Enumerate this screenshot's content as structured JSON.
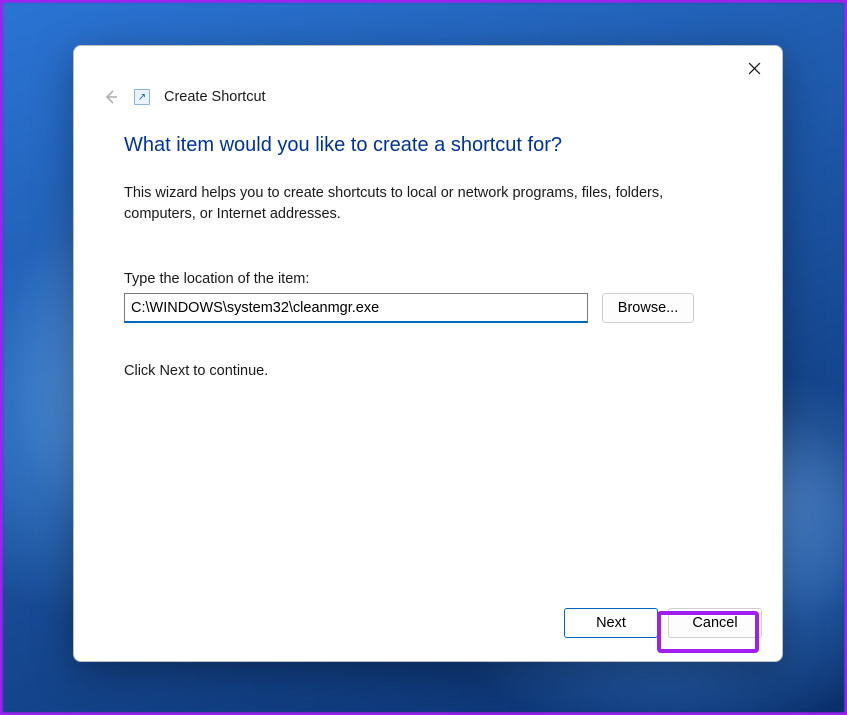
{
  "window": {
    "title": "Create Shortcut"
  },
  "wizard": {
    "heading": "What item would you like to create a shortcut for?",
    "description": "This wizard helps you to create shortcuts to local or network programs, files, folders, computers, or Internet addresses.",
    "location_label": "Type the location of the item:",
    "location_value": "C:\\WINDOWS\\system32\\cleanmgr.exe",
    "browse_label": "Browse...",
    "continue_hint": "Click Next to continue."
  },
  "footer": {
    "next_label": "Next",
    "cancel_label": "Cancel"
  }
}
